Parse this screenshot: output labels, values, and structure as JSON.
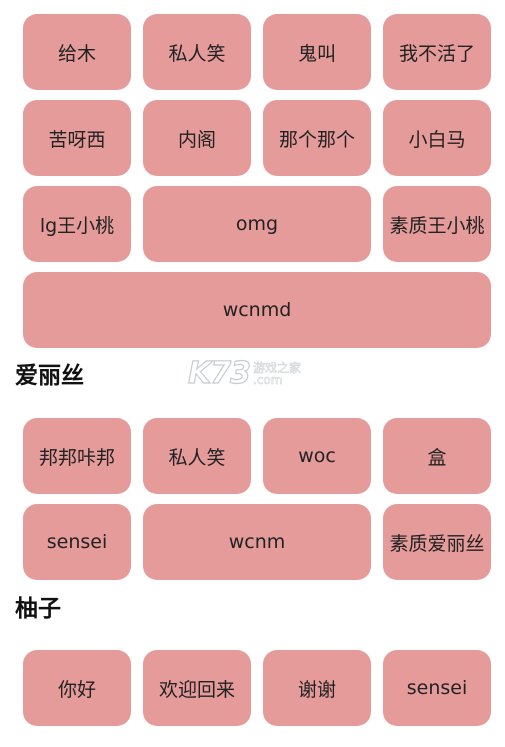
{
  "section1": {
    "buttons": [
      "给木",
      "私人笑",
      "鬼叫",
      "我不活了",
      "苦呀西",
      "内阁",
      "那个那个",
      "小白马",
      "lg王小桃",
      "omg",
      "素质王小桃",
      "wcnmd"
    ]
  },
  "section2": {
    "title": "爱丽丝",
    "buttons": [
      "邦邦咔邦",
      "私人笑",
      "woc",
      "盒",
      "sensei",
      "wcnm",
      "素质爱丽丝"
    ]
  },
  "section3": {
    "title": "柚子",
    "buttons": [
      "你好",
      "欢迎回来",
      "谢谢",
      "sensei"
    ]
  },
  "watermark": {
    "logo": "K73",
    "line1": "游戏之家",
    "line2": ".com"
  },
  "colors": {
    "button_bg": "#e69b9b",
    "button_text": "#222222",
    "title_text": "#111111"
  }
}
